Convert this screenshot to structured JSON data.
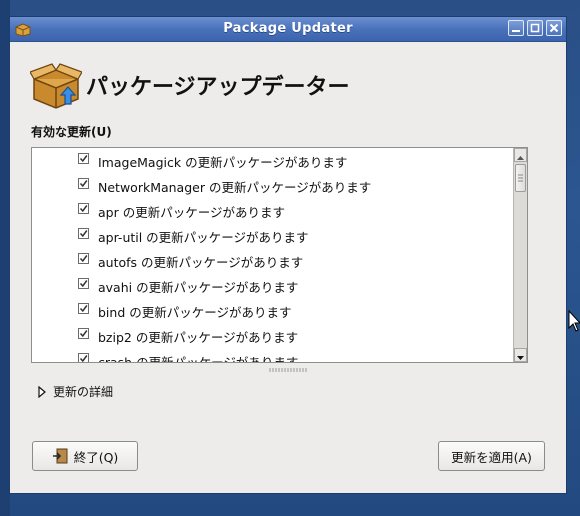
{
  "window": {
    "title": "Package Updater"
  },
  "header": {
    "title": "パッケージアップデーター"
  },
  "updates_list": {
    "label": "有効な更新(U)",
    "items": [
      {
        "text": "ImageMagick の更新パッケージがあります",
        "checked": true
      },
      {
        "text": "NetworkManager の更新パッケージがあります",
        "checked": true
      },
      {
        "text": "apr の更新パッケージがあります",
        "checked": true
      },
      {
        "text": "apr-util の更新パッケージがあります",
        "checked": true
      },
      {
        "text": "autofs の更新パッケージがあります",
        "checked": true
      },
      {
        "text": "avahi の更新パッケージがあります",
        "checked": true
      },
      {
        "text": "bind の更新パッケージがあります",
        "checked": true
      },
      {
        "text": "bzip2 の更新パッケージがあります",
        "checked": true
      },
      {
        "text": "crash の更新パッケージがあります",
        "checked": true
      }
    ]
  },
  "details_expander": {
    "label": "更新の詳細"
  },
  "buttons": {
    "quit": "終了(Q)",
    "apply": "更新を適用(A)"
  },
  "icons": {
    "window_menu": "package-updater-icon",
    "header": "package-box-upload-icon",
    "quit": "exit-door-icon"
  }
}
